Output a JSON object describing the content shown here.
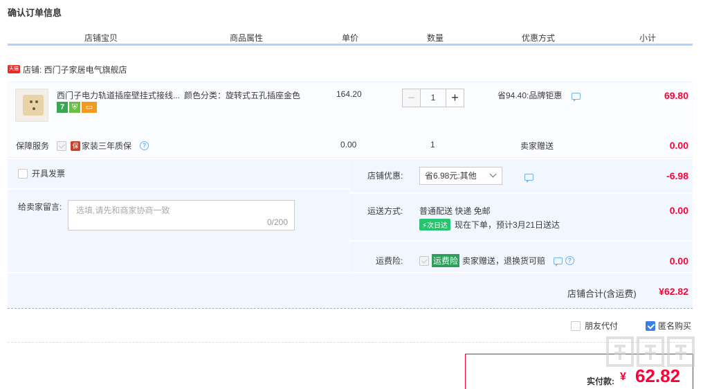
{
  "page_title": "确认订单信息",
  "columns": [
    "店铺宝贝",
    "商品属性",
    "单价",
    "数量",
    "优惠方式",
    "小计"
  ],
  "shop": {
    "badge": "天猫",
    "label": "店铺: 西门子家居电气旗舰店"
  },
  "item": {
    "name": "西门子电力轨道插座壁挂式接线...",
    "attribute": "颜色分类：旋转式五孔插座金色",
    "unit_price": "164.20",
    "quantity": "1",
    "discount": "省94.40:品牌钜惠",
    "subtotal": "69.80",
    "tag_seven": "7"
  },
  "service": {
    "label": "保障服务",
    "icon_text": "保",
    "name": "家装三年质保",
    "price": "0.00",
    "qty": "1",
    "gift": "卖家赠送",
    "subtotal": "0.00"
  },
  "invoice_label": "开具发票",
  "message": {
    "label": "给卖家留言:",
    "placeholder": "选填,请先和商家协商一致",
    "count": "0/200"
  },
  "coupon": {
    "label": "店铺优惠:",
    "selected": "省6.98元:其他",
    "value": "-6.98"
  },
  "shipping": {
    "label": "运送方式:",
    "text": "普通配送 快递 免邮",
    "badge": "次日达",
    "eta": "现在下单，预计3月21日送达",
    "value": "0.00"
  },
  "insurance": {
    "label": "运费险:",
    "tag": "运费险",
    "text": "卖家赠送，退换货可赔",
    "value": "0.00"
  },
  "shop_total": {
    "label": "店铺合计(含运费)",
    "value": "¥62.82"
  },
  "options": {
    "friend_pay": "朋友代付",
    "anonymous": "匿名购买"
  },
  "payment": {
    "label": "实付款:",
    "currency": "¥",
    "value": "62.82"
  },
  "colors": {
    "accent_red": "#ff0036",
    "header_border": "#b2d1ff",
    "panel_bg": "#f2f7ff"
  }
}
